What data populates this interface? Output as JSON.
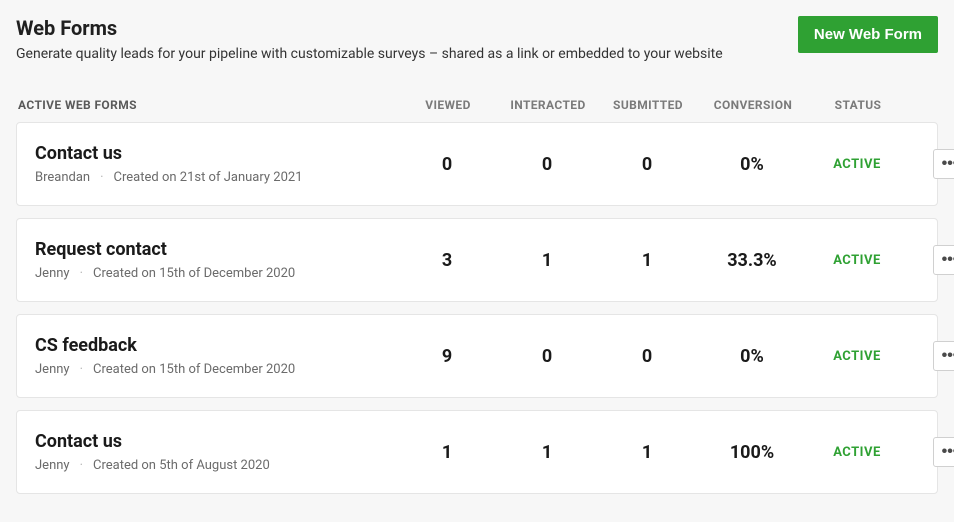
{
  "header": {
    "title": "Web Forms",
    "subtitle": "Generate quality leads for your pipeline with customizable surveys – shared as a link or embedded to your website",
    "newButton": "New Web Form"
  },
  "columns": {
    "name": "ACTIVE WEB FORMS",
    "viewed": "VIEWED",
    "interacted": "INTERACTED",
    "submitted": "SUBMITTED",
    "conversion": "CONVERSION",
    "status": "STATUS"
  },
  "rows": [
    {
      "title": "Contact us",
      "author": "Breandan",
      "created": "Created on 21st of January 2021",
      "viewed": "0",
      "interacted": "0",
      "submitted": "0",
      "conversion": "0%",
      "status": "ACTIVE"
    },
    {
      "title": "Request contact",
      "author": "Jenny",
      "created": "Created on 15th of December 2020",
      "viewed": "3",
      "interacted": "1",
      "submitted": "1",
      "conversion": "33.3%",
      "status": "ACTIVE"
    },
    {
      "title": "CS feedback",
      "author": "Jenny",
      "created": "Created on 15th of December 2020",
      "viewed": "9",
      "interacted": "0",
      "submitted": "0",
      "conversion": "0%",
      "status": "ACTIVE"
    },
    {
      "title": "Contact us",
      "author": "Jenny",
      "created": "Created on 5th of August 2020",
      "viewed": "1",
      "interacted": "1",
      "submitted": "1",
      "conversion": "100%",
      "status": "ACTIVE"
    }
  ],
  "icons": {
    "more": "•••"
  }
}
